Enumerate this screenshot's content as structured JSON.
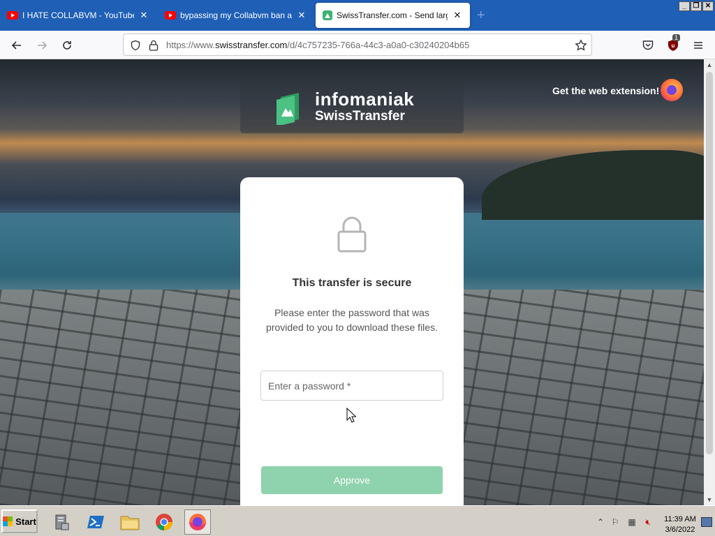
{
  "browser": {
    "tabs": [
      {
        "title": "I HATE COLLABVM - YouTube",
        "icon": "youtube-icon",
        "active": false
      },
      {
        "title": "bypassing my Collabvm ban and an",
        "icon": "youtube-icon",
        "active": false
      },
      {
        "title": "SwissTransfer.com - Send large file",
        "icon": "swisstransfer-icon",
        "active": true
      }
    ],
    "new_tab_label": "+",
    "close_glyph": "✕",
    "url_prefix": "https://www.",
    "url_domain": "swisstransfer.com",
    "url_path": "/d/4c757235-766a-44c3-a0a0-c30240204b65",
    "ublock_badge": "1"
  },
  "page": {
    "brand_name": "infomaniak",
    "product_name": "SwissTransfer",
    "extension_link": "Get the web extension!",
    "card": {
      "title": "This transfer is secure",
      "description": "Please enter the password that was provided to you to download these files.",
      "password_placeholder": "Enter a password *",
      "approve_label": "Approve"
    },
    "accent_color": "#8fd2ae"
  },
  "taskbar": {
    "start_label": "Start",
    "time": "11:39 AM",
    "date": "3/6/2022"
  }
}
